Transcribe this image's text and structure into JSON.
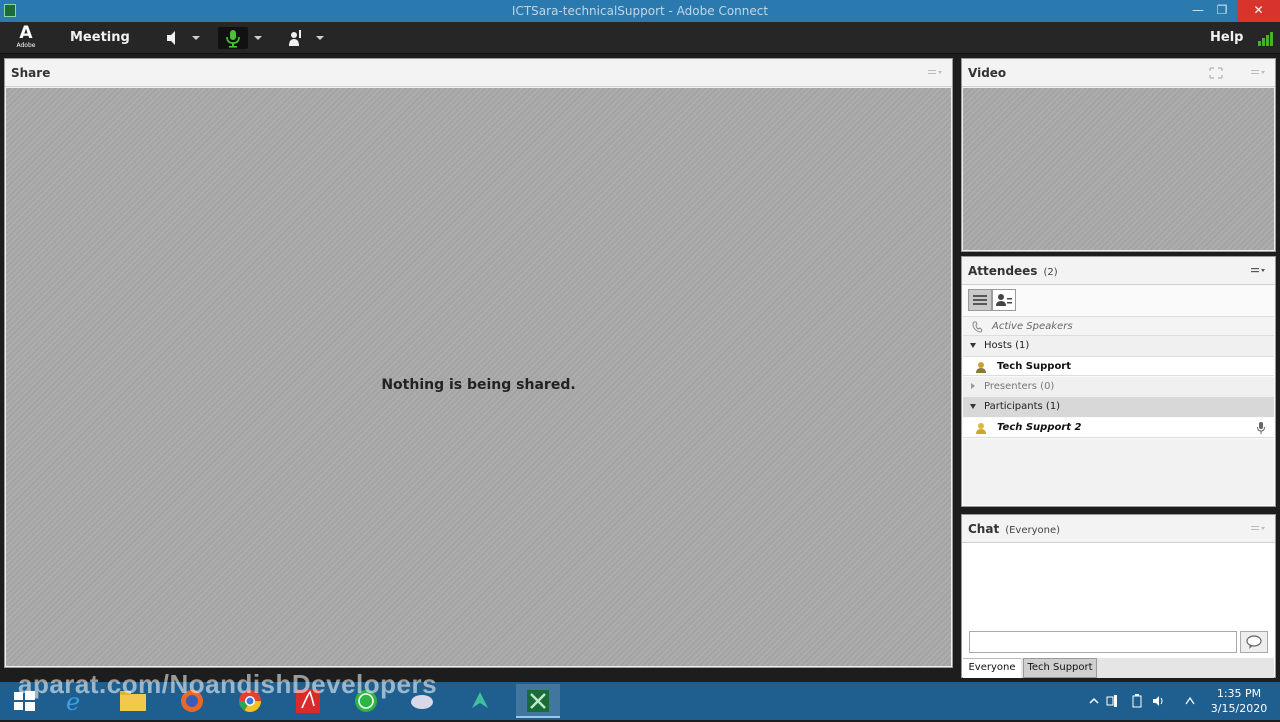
{
  "window": {
    "title": "ICTSara-technicalSupport - Adobe Connect",
    "minimize": "—",
    "maximize": "❐",
    "close": "✕"
  },
  "menubar": {
    "logo_mark": "A",
    "logo_text": "Adobe",
    "meeting_label": "Meeting",
    "help_label": "Help",
    "mic_active_color": "#48c234",
    "signal_color": "#4caf2b"
  },
  "share_pod": {
    "title": "Share",
    "message": "Nothing is being shared."
  },
  "video_pod": {
    "title": "Video"
  },
  "attendees_pod": {
    "title": "Attendees",
    "count": "(2)",
    "active_speakers": "Active Speakers",
    "hosts_label": "Hosts (1)",
    "hosts": [
      "Tech Support"
    ],
    "presenters_label": "Presenters (0)",
    "participants_label": "Participants (1)",
    "participants": [
      "Tech Support 2"
    ]
  },
  "chat_pod": {
    "title": "Chat",
    "scope": "(Everyone)",
    "input_placeholder": "",
    "tabs": [
      "Everyone",
      "Tech Support"
    ]
  },
  "taskbar": {
    "watermark": "aparat.com/NoandishDevelopers",
    "time": "1:35 PM",
    "date": "3/15/2020",
    "apps": [
      "windows-start",
      "internet-explorer",
      "file-explorer",
      "firefox",
      "chrome",
      "acrobat",
      "whatsapp",
      "app-cloud",
      "app-arrow",
      "adobe-connect"
    ]
  }
}
